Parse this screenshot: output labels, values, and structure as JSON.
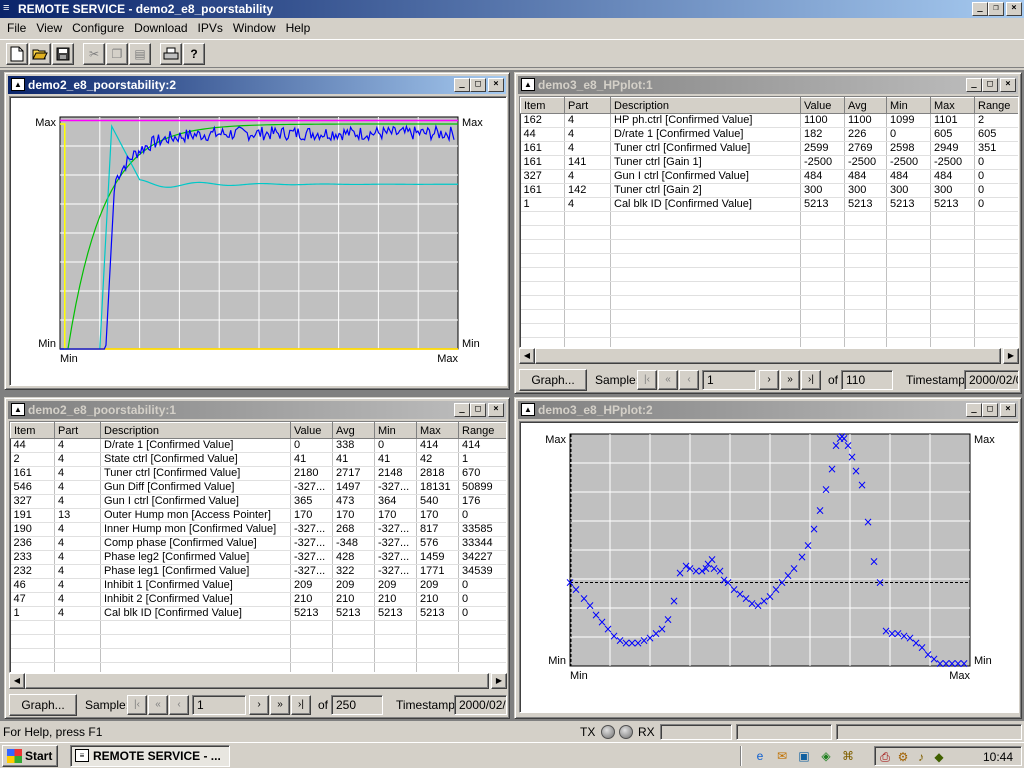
{
  "app": {
    "title": "REMOTE SERVICE - demo2_e8_poorstability",
    "caption_minimize": "_",
    "caption_restore": "❐",
    "caption_close": "×"
  },
  "menu": [
    "File",
    "View",
    "Configure",
    "Download",
    "IPVs",
    "Window",
    "Help"
  ],
  "toolbar": {
    "icons": [
      "new-document-icon",
      "open-folder-icon",
      "save-disk-icon",
      "cut-icon",
      "copy-icon",
      "paste-icon",
      "print-icon",
      "help-icon"
    ],
    "help_glyph": "?"
  },
  "windows": {
    "top_left": {
      "title": "demo2_e8_poorstability:2",
      "chart_data": {
        "type": "line",
        "y_left_top": "Max",
        "y_left_bottom": "Min",
        "y_right_top": "Max",
        "y_right_bottom": "Min",
        "x_left": "Min",
        "x_right": "Max",
        "grid": true,
        "series_colors": [
          "#0000ff",
          "#00c8c8",
          "#00c000",
          "#ffff00",
          "#ff00ff",
          "#ff0000"
        ]
      }
    },
    "top_right": {
      "title": "demo3_e8_HPplot:1",
      "columns": [
        "Item",
        "Part",
        "Description",
        "Value",
        "Avg",
        "Min",
        "Max",
        "Range"
      ],
      "rows": [
        [
          "162",
          "4",
          "HP ph.ctrl [Confirmed Value]",
          "1100",
          "1100",
          "1099",
          "1101",
          "2"
        ],
        [
          "44",
          "4",
          "D/rate 1 [Confirmed Value]",
          "182",
          "226",
          "0",
          "605",
          "605"
        ],
        [
          "161",
          "4",
          "Tuner ctrl [Confirmed Value]",
          "2599",
          "2769",
          "2598",
          "2949",
          "351"
        ],
        [
          "161",
          "141",
          "Tuner ctrl [Gain 1]",
          "-2500",
          "-2500",
          "-2500",
          "-2500",
          "0"
        ],
        [
          "327",
          "4",
          "Gun I ctrl [Confirmed Value]",
          "484",
          "484",
          "484",
          "484",
          "0"
        ],
        [
          "161",
          "142",
          "Tuner ctrl [Gain 2]",
          "300",
          "300",
          "300",
          "300",
          "0"
        ],
        [
          "1",
          "4",
          "Cal blk ID [Confirmed Value]",
          "5213",
          "5213",
          "5213",
          "5213",
          "0"
        ]
      ],
      "graph_button": "Graph...",
      "sample_label": "Sample:",
      "sample_value": "1",
      "of_label": "of",
      "of_value": "110",
      "timestamp_label": "Timestamp:",
      "timestamp_value": "2000/02/0"
    },
    "bottom_left": {
      "title": "demo2_e8_poorstability:1",
      "columns": [
        "Item",
        "Part",
        "Description",
        "Value",
        "Avg",
        "Min",
        "Max",
        "Range"
      ],
      "rows": [
        [
          "44",
          "4",
          "D/rate 1 [Confirmed Value]",
          "0",
          "338",
          "0",
          "414",
          "414"
        ],
        [
          "2",
          "4",
          "State ctrl [Confirmed Value]",
          "41",
          "41",
          "41",
          "42",
          "1"
        ],
        [
          "161",
          "4",
          "Tuner ctrl [Confirmed Value]",
          "2180",
          "2717",
          "2148",
          "2818",
          "670"
        ],
        [
          "546",
          "4",
          "Gun Diff [Confirmed Value]",
          "-327...",
          "1497",
          "-327...",
          "18131",
          "50899"
        ],
        [
          "327",
          "4",
          "Gun I ctrl [Confirmed Value]",
          "365",
          "473",
          "364",
          "540",
          "176"
        ],
        [
          "191",
          "13",
          "Outer Hump mon [Access Pointer]",
          "170",
          "170",
          "170",
          "170",
          "0"
        ],
        [
          "190",
          "4",
          "Inner Hump mon [Confirmed Value]",
          "-327...",
          "268",
          "-327...",
          "817",
          "33585"
        ],
        [
          "236",
          "4",
          "Comp phase [Confirmed Value]",
          "-327...",
          "-348",
          "-327...",
          "576",
          "33344"
        ],
        [
          "233",
          "4",
          "Phase leg2 [Confirmed Value]",
          "-327...",
          "428",
          "-327...",
          "1459",
          "34227"
        ],
        [
          "232",
          "4",
          "Phase leg1 [Confirmed Value]",
          "-327...",
          "322",
          "-327...",
          "1771",
          "34539"
        ],
        [
          "46",
          "4",
          "Inhibit 1 [Confirmed Value]",
          "209",
          "209",
          "209",
          "209",
          "0"
        ],
        [
          "47",
          "4",
          "Inhibit 2 [Confirmed Value]",
          "210",
          "210",
          "210",
          "210",
          "0"
        ],
        [
          "1",
          "4",
          "Cal blk ID [Confirmed Value]",
          "5213",
          "5213",
          "5213",
          "5213",
          "0"
        ]
      ],
      "graph_button": "Graph...",
      "sample_label": "Sample:",
      "sample_value": "1",
      "of_label": "of",
      "of_value": "250",
      "timestamp_label": "Timestamp:",
      "timestamp_value": "2000/02/0"
    },
    "bottom_right": {
      "title": "demo3_e8_HPplot:2",
      "chart_data": {
        "type": "scatter",
        "y_left_top": "Max",
        "y_left_bottom": "Min",
        "y_right_top": "Max",
        "y_right_bottom": "Min",
        "x_left": "Min",
        "x_right": "Max",
        "grid": true,
        "marker": "×",
        "marker_color": "#0000ff",
        "reference_level": 0.36,
        "x": [
          0.0,
          0.015,
          0.035,
          0.05,
          0.065,
          0.08,
          0.095,
          0.11,
          0.125,
          0.14,
          0.155,
          0.17,
          0.185,
          0.2,
          0.215,
          0.23,
          0.245,
          0.26,
          0.275,
          0.29,
          0.3,
          0.315,
          0.33,
          0.34,
          0.345,
          0.355,
          0.36,
          0.375,
          0.385,
          0.395,
          0.41,
          0.425,
          0.44,
          0.455,
          0.47,
          0.485,
          0.5,
          0.515,
          0.53,
          0.545,
          0.56,
          0.58,
          0.595,
          0.61,
          0.625,
          0.64,
          0.655,
          0.665,
          0.675,
          0.68,
          0.685,
          0.695,
          0.705,
          0.715,
          0.73,
          0.745,
          0.76,
          0.775,
          0.79,
          0.805,
          0.82,
          0.835,
          0.85,
          0.865,
          0.88,
          0.895,
          0.91,
          0.925,
          0.94,
          0.955,
          0.97,
          0.985
        ],
        "y": [
          0.36,
          0.33,
          0.29,
          0.26,
          0.22,
          0.19,
          0.16,
          0.13,
          0.11,
          0.1,
          0.1,
          0.1,
          0.11,
          0.12,
          0.14,
          0.16,
          0.2,
          0.28,
          0.4,
          0.43,
          0.42,
          0.41,
          0.41,
          0.42,
          0.44,
          0.46,
          0.42,
          0.41,
          0.37,
          0.36,
          0.33,
          0.31,
          0.29,
          0.27,
          0.26,
          0.28,
          0.3,
          0.33,
          0.36,
          0.39,
          0.42,
          0.47,
          0.52,
          0.59,
          0.67,
          0.76,
          0.85,
          0.95,
          0.98,
          0.99,
          0.98,
          0.95,
          0.9,
          0.84,
          0.78,
          0.62,
          0.45,
          0.36,
          0.15,
          0.14,
          0.14,
          0.13,
          0.12,
          0.1,
          0.08,
          0.05,
          0.03,
          0.01,
          0.01,
          0.01,
          0.01,
          0.01
        ]
      }
    }
  },
  "statusbar": {
    "help_text": "For Help, press F1",
    "tx_label": "TX",
    "rx_label": "RX"
  },
  "taskbar": {
    "start_label": "Start",
    "task_label": "REMOTE SERVICE - ...",
    "clock": "10:44",
    "tray_icons": [
      "ie-icon",
      "outlook-icon",
      "desktop-icon",
      "channel-icon",
      "network-icon",
      "printer-icon",
      "volume-icon",
      "sync-icon"
    ]
  }
}
